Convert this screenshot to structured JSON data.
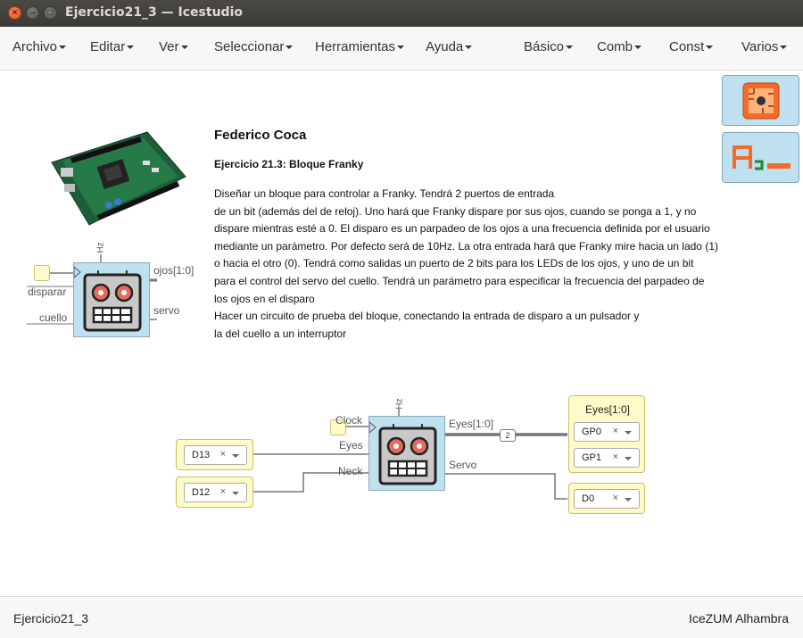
{
  "window": {
    "title": "Ejercicio21_3 — Icestudio"
  },
  "menu": {
    "left": [
      "Archivo",
      "Editar",
      "Ver",
      "Seleccionar",
      "Herramientas",
      "Ayuda"
    ],
    "right": [
      "Básico",
      "Comb",
      "Const",
      "Varios"
    ]
  },
  "info": {
    "author": "Federico Coca",
    "subtitle": "Ejercicio 21.3: Bloque Franky",
    "paragraph": [
      "Diseñar un bloque para controlar a Franky. Tendrá 2 puertos de entrada",
      "de un bit (además del de reloj). Uno hará que Franky dispare por sus ojos, cuando se ponga a 1, y no",
      "dispare mientras esté a 0. El disparo es un parpadeo de los ojos a una frecuencia definida por el usuario",
      "mediante un parámetro. Por defecto será de 10Hz. La otra entrada hará que Franky mire hacia un lado (1)",
      "o hacia el otro (0). Tendrá como salidas un puerto de 2 bits para los LEDs de los ojos, y uno de un bit",
      "para el control del servo del cuello. Tendrá un parámetro para especificar la frecuencia del parpadeo de",
      "los ojos en el disparo",
      "Hacer un circuito de prueba del bloque, conectando la entrada de disparo a un pulsador y",
      "la del cuello a un interruptor"
    ]
  },
  "example_block": {
    "param": "Hz",
    "inputs": [
      "disparar",
      "cuello"
    ],
    "outputs": [
      "ojos[1:0]",
      "servo"
    ]
  },
  "circuit": {
    "param": "Hz",
    "input_labels": [
      "Clock",
      "Eyes",
      "Neck"
    ],
    "output_labels": [
      "Eyes[1:0]",
      "Servo"
    ],
    "bus_width": "2",
    "inputs": [
      {
        "pin": "D13"
      },
      {
        "pin": "D12"
      }
    ],
    "eyes_group": {
      "title": "Eyes[1:0]",
      "pins": [
        "GP0",
        "GP1"
      ]
    },
    "servo_pin": "D0",
    "select_clear": "×"
  },
  "toolbox": {
    "icons": [
      "chip-icon",
      "text-label-icon"
    ]
  },
  "status": {
    "left": "Ejercicio21_3",
    "right": "IceZUM Alhambra"
  },
  "colors": {
    "block_fill": "#bfe0ee",
    "io_fill": "#fffbc8",
    "close_button": "#e5531d"
  }
}
